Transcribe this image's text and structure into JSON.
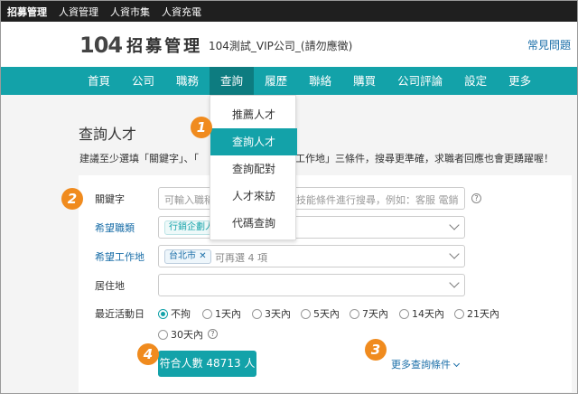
{
  "topbar": {
    "items": [
      "招募管理",
      "人資管理",
      "人資市集",
      "人資充電"
    ]
  },
  "header": {
    "logo_num": "104",
    "logo_text": "招募管理",
    "company": "104測試_VIP公司_(請勿應徵)",
    "faq": "常見問題"
  },
  "nav": {
    "items": [
      "首頁",
      "公司",
      "職務",
      "查詢",
      "履歷",
      "聯絡",
      "購買",
      "公司評論",
      "設定",
      "更多"
    ]
  },
  "dropdown": {
    "items": [
      "推薦人才",
      "查詢人才",
      "查詢配對",
      "人才來訪",
      "代碼查詢"
    ]
  },
  "page": {
    "title": "查詢人才",
    "tip_left": "建議至少選填「關鍵字」、「",
    "tip_right": "望工作地」三條件，搜尋更準確，求職者回應也會更踴躍喔！"
  },
  "form": {
    "keyword_label": "關鍵字",
    "keyword_placeholder": "可輸入職稱、技能條件進行搜尋，例如：客服 電銷",
    "keyword_placeholder_left": "可輸入職稱",
    "keyword_placeholder_right": "技能條件進行搜尋，例如：客服 電銷",
    "category_label": "希望職類",
    "category_tag": "行銷企劃人",
    "location_label": "希望工作地",
    "location_tag": "台北市",
    "location_hint": "可再選 4 項",
    "residence_label": "居住地",
    "activity_label": "最近活動日",
    "activity_options": [
      "不拘",
      "1天內",
      "3天內",
      "5天內",
      "7天內",
      "14天內",
      "21天內",
      "30天內"
    ],
    "activity_selected": "不拘",
    "submit": "符合人數 48713 人",
    "more": "更多查詢條件"
  },
  "badges": [
    "1",
    "2",
    "3",
    "4"
  ],
  "colors": {
    "accent": "#13a2a9",
    "badge": "#f08b1e",
    "link": "#1a6ea8"
  }
}
